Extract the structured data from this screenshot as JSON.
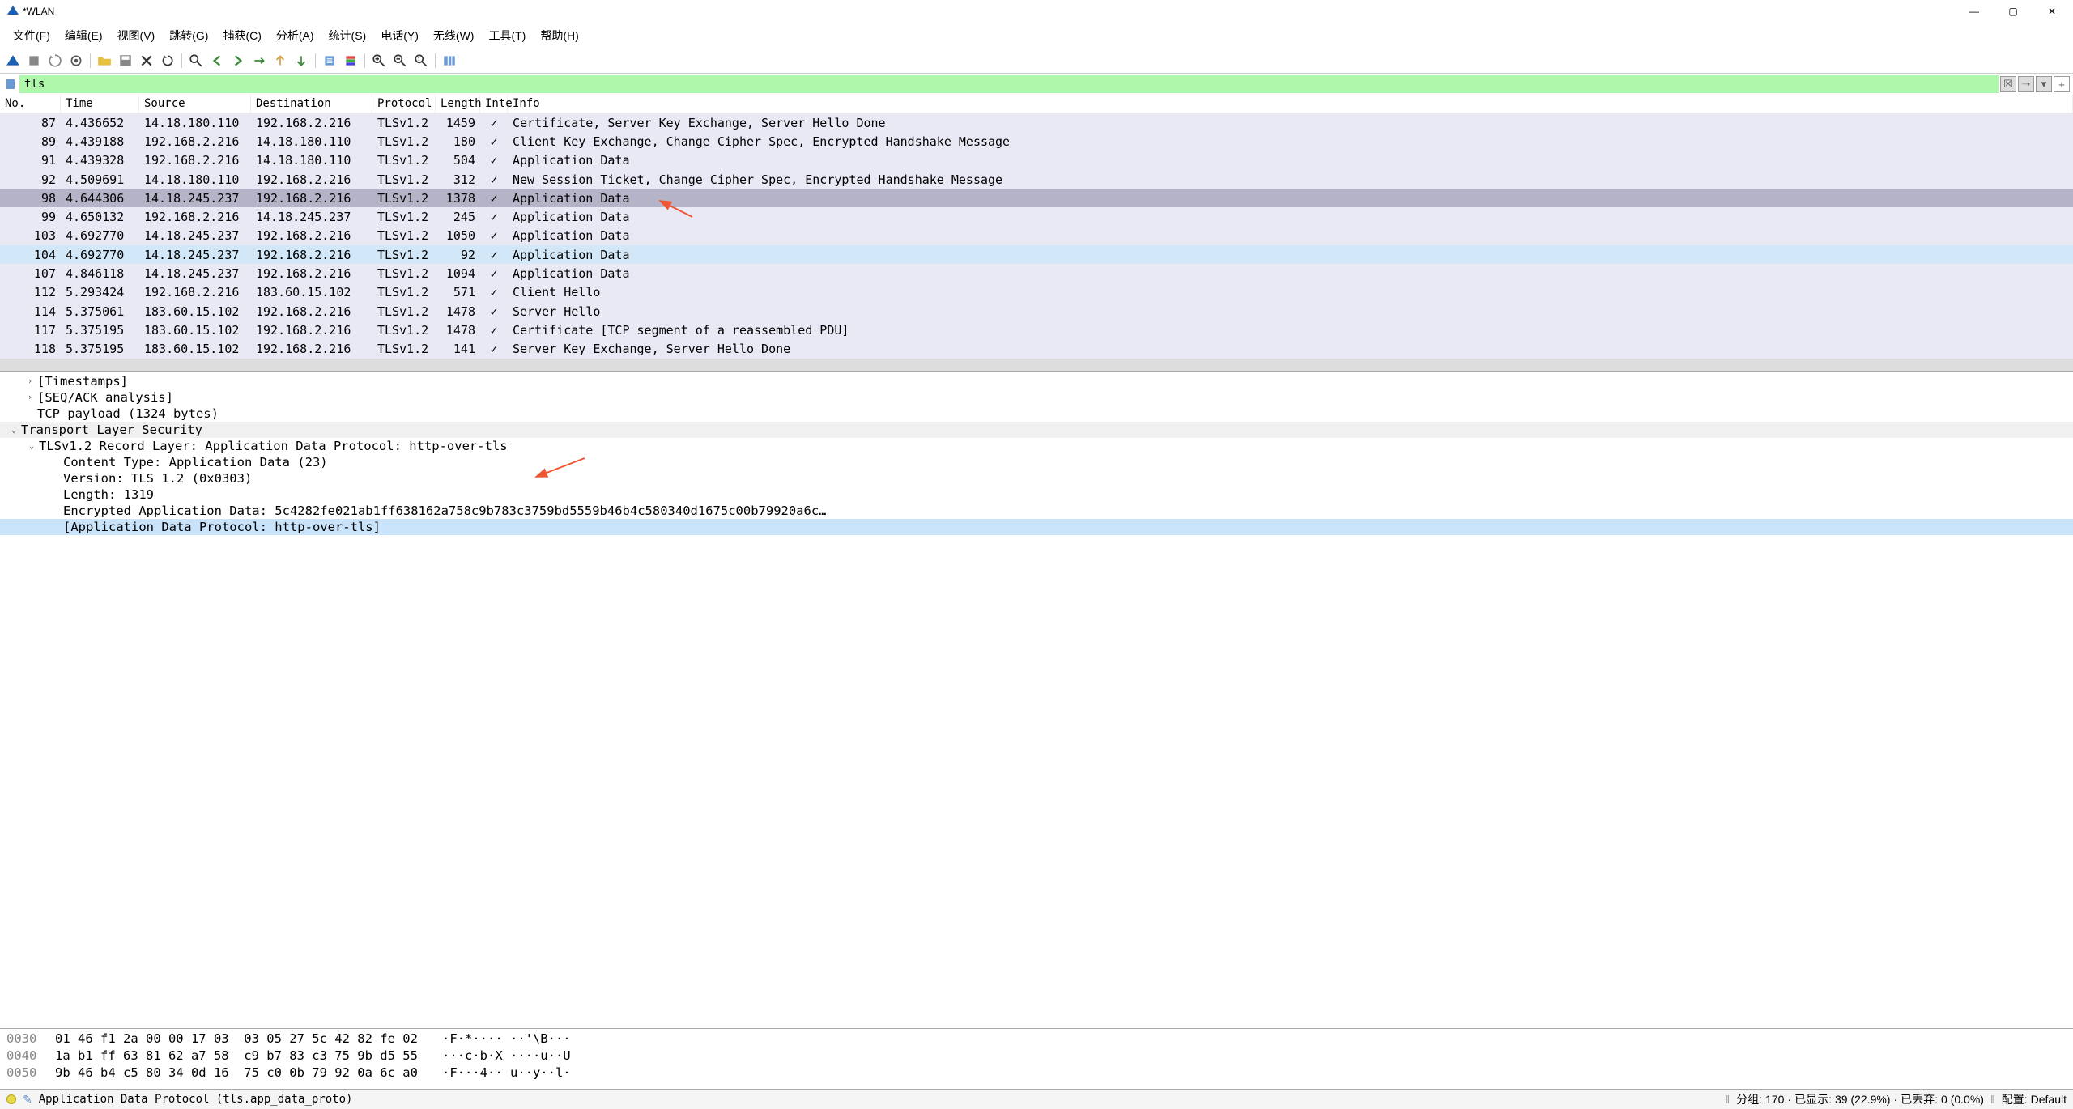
{
  "window": {
    "title": "*WLAN"
  },
  "menu": [
    "文件(F)",
    "编辑(E)",
    "视图(V)",
    "跳转(G)",
    "捕获(C)",
    "分析(A)",
    "统计(S)",
    "电话(Y)",
    "无线(W)",
    "工具(T)",
    "帮助(H)"
  ],
  "filter": {
    "value": "tls"
  },
  "columns": {
    "no": "No.",
    "time": "Time",
    "source": "Source",
    "destination": "Destination",
    "protocol": "Protocol",
    "length": "Length",
    "inte": "Inte",
    "info": "Info"
  },
  "packets": [
    {
      "no": "87",
      "time": "4.436652",
      "src": "14.18.180.110",
      "dst": "192.168.2.216",
      "proto": "TLSv1.2",
      "len": "1459",
      "inte": "✓",
      "info": "Certificate, Server Key Exchange, Server Hello Done",
      "cls": "light"
    },
    {
      "no": "89",
      "time": "4.439188",
      "src": "192.168.2.216",
      "dst": "14.18.180.110",
      "proto": "TLSv1.2",
      "len": "180",
      "inte": "✓",
      "info": "Client Key Exchange, Change Cipher Spec, Encrypted Handshake Message",
      "cls": "light"
    },
    {
      "no": "91",
      "time": "4.439328",
      "src": "192.168.2.216",
      "dst": "14.18.180.110",
      "proto": "TLSv1.2",
      "len": "504",
      "inte": "✓",
      "info": "Application Data",
      "cls": "light"
    },
    {
      "no": "92",
      "time": "4.509691",
      "src": "14.18.180.110",
      "dst": "192.168.2.216",
      "proto": "TLSv1.2",
      "len": "312",
      "inte": "✓",
      "info": "New Session Ticket, Change Cipher Spec, Encrypted Handshake Message",
      "cls": "light"
    },
    {
      "no": "98",
      "time": "4.644306",
      "src": "14.18.245.237",
      "dst": "192.168.2.216",
      "proto": "TLSv1.2",
      "len": "1378",
      "inte": "✓",
      "info": "Application Data",
      "cls": "selected"
    },
    {
      "no": "99",
      "time": "4.650132",
      "src": "192.168.2.216",
      "dst": "14.18.245.237",
      "proto": "TLSv1.2",
      "len": "245",
      "inte": "✓",
      "info": "Application Data",
      "cls": "light"
    },
    {
      "no": "103",
      "time": "4.692770",
      "src": "14.18.245.237",
      "dst": "192.168.2.216",
      "proto": "TLSv1.2",
      "len": "1050",
      "inte": "✓",
      "info": "Application Data",
      "cls": "light"
    },
    {
      "no": "104",
      "time": "4.692770",
      "src": "14.18.245.237",
      "dst": "192.168.2.216",
      "proto": "TLSv1.2",
      "len": "92",
      "inte": "✓",
      "info": "Application Data",
      "cls": "highlight"
    },
    {
      "no": "107",
      "time": "4.846118",
      "src": "14.18.245.237",
      "dst": "192.168.2.216",
      "proto": "TLSv1.2",
      "len": "1094",
      "inte": "✓",
      "info": "Application Data",
      "cls": "light"
    },
    {
      "no": "112",
      "time": "5.293424",
      "src": "192.168.2.216",
      "dst": "183.60.15.102",
      "proto": "TLSv1.2",
      "len": "571",
      "inte": "✓",
      "info": "Client Hello",
      "cls": "light"
    },
    {
      "no": "114",
      "time": "5.375061",
      "src": "183.60.15.102",
      "dst": "192.168.2.216",
      "proto": "TLSv1.2",
      "len": "1478",
      "inte": "✓",
      "info": "Server Hello",
      "cls": "light"
    },
    {
      "no": "117",
      "time": "5.375195",
      "src": "183.60.15.102",
      "dst": "192.168.2.216",
      "proto": "TLSv1.2",
      "len": "1478",
      "inte": "✓",
      "info": "Certificate [TCP segment of a reassembled PDU]",
      "cls": "light"
    },
    {
      "no": "118",
      "time": "5.375195",
      "src": "183.60.15.102",
      "dst": "192.168.2.216",
      "proto": "TLSv1.2",
      "len": "141",
      "inte": "✓",
      "info": "Server Key Exchange, Server Hello Done",
      "cls": "light"
    }
  ],
  "details": {
    "timestamps": "[Timestamps]",
    "seqack": "[SEQ/ACK analysis]",
    "tcppayload": "TCP payload (1324 bytes)",
    "tls": "Transport Layer Security",
    "record": "TLSv1.2 Record Layer: Application Data Protocol: http-over-tls",
    "ctype": "Content Type: Application Data (23)",
    "version": "Version: TLS 1.2 (0x0303)",
    "length": "Length: 1319",
    "encdata": "Encrypted Application Data: 5c4282fe021ab1ff638162a758c9b783c3759bd5559b46b4c580340d1675c00b79920a6c…",
    "appproto": "[Application Data Protocol: http-over-tls]"
  },
  "hex": [
    {
      "off": "0030",
      "bytes": "01 46 f1 2a 00 00 17 03  03 05 27 5c 42 82 fe 02",
      "asc": "·F·*···· ··'\\B···"
    },
    {
      "off": "0040",
      "bytes": "1a b1 ff 63 81 62 a7 58  c9 b7 83 c3 75 9b d5 55",
      "asc": "···c·b·X ····u··U"
    },
    {
      "off": "0050",
      "bytes": "9b 46 b4 c5 80 34 0d 16  75 c0 0b 79 92 0a 6c a0",
      "asc": "·F···4·· u··y··l·"
    }
  ],
  "status": {
    "left": "Application Data Protocol (tls.app_data_proto)",
    "packets_label": "分组:",
    "packets": "170",
    "displayed_label": "已显示:",
    "displayed": "39 (22.9%)",
    "dropped_label": "已丢弃:",
    "dropped": "0 (0.0%)",
    "profile_label": "配置:",
    "profile": "Default"
  }
}
